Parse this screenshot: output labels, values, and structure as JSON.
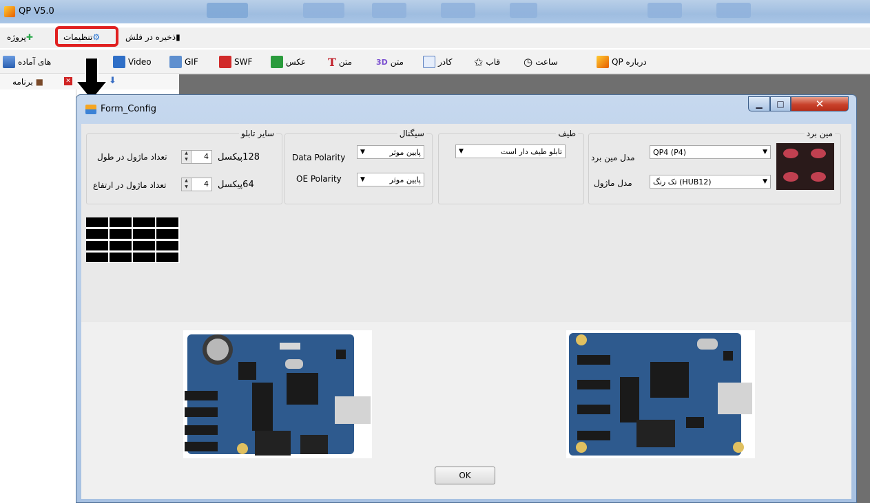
{
  "app": {
    "title": "QP  V5.0"
  },
  "menu": {
    "project": "پروژه",
    "settings": "تنظیمات",
    "save_flash": "ذخیره در فلش"
  },
  "toolbar": {
    "ready": "های آماده",
    "video": "Video",
    "gif": "GIF",
    "swf": "SWF",
    "photo": "عکس",
    "text": "متن",
    "text3d": "متن",
    "frame": "کادر",
    "shape": "قاب",
    "clock": "ساعت",
    "about": "درباره QP"
  },
  "subbar": {
    "program": "برنامه"
  },
  "dialog": {
    "title": "Form_Config",
    "groups": {
      "other": {
        "legend": "سایر تابلو",
        "row1": {
          "label": "تعداد ماژول در طول",
          "value": "4",
          "pixels": "128پیکسل"
        },
        "row2": {
          "label": "تعداد ماژول در ارتفاع",
          "value": "4",
          "pixels": "64پیکسل"
        }
      },
      "signal": {
        "legend": "سیگنال",
        "data_polarity_label": "Data Polarity",
        "data_polarity_value": "پایین موثر",
        "oe_polarity_label": "OE Polarity",
        "oe_polarity_value": "پایین موثر"
      },
      "spectrum": {
        "legend": "طیف",
        "value": "تابلو طیف دار است"
      },
      "mainboard": {
        "legend": "مین برد",
        "model_label": "مدل مین برد",
        "model_value": "QP4  (P4)",
        "module_label": "مدل ماژول",
        "module_value": "(HUB12) تک رنگ"
      }
    },
    "ok": "OK"
  }
}
